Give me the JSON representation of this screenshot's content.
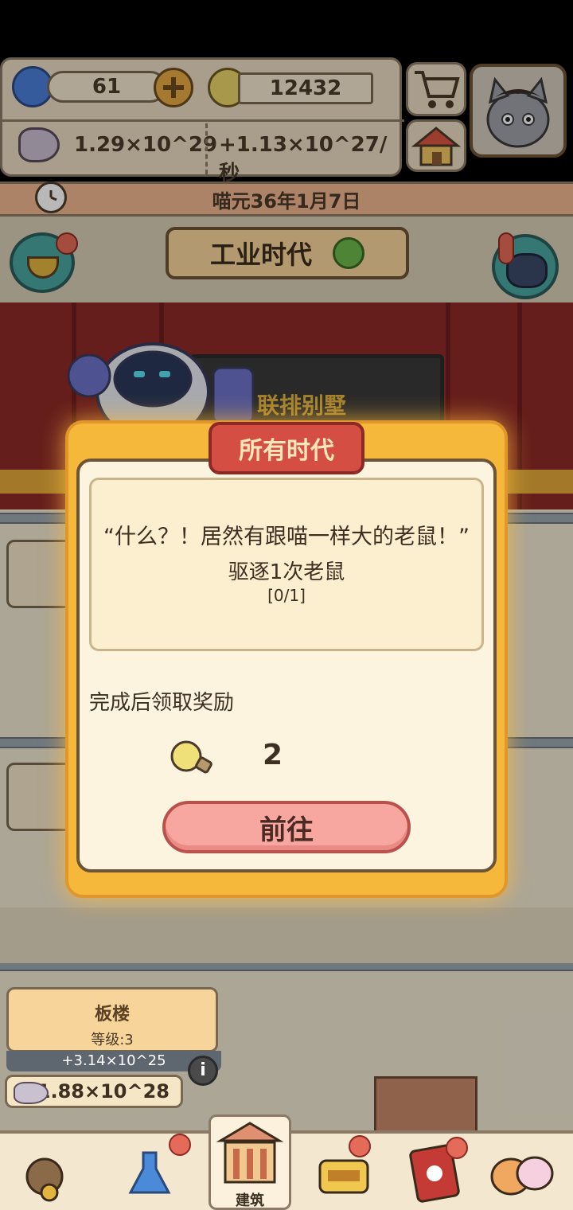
{
  "resources": {
    "gems": "61",
    "bulbs": "12432",
    "fish": "1.29×10^29",
    "fish_rate": "+1.13×10^27/秒"
  },
  "date": "喵元36年1月7日",
  "era": "工业时代",
  "stage_sign": "联排别墅",
  "dialog": {
    "title": "所有时代",
    "quest_quote": "“什么？！居然有跟喵一样大的老鼠！”",
    "quest_task": "驱逐1次老鼠",
    "quest_progress": "[0/1]",
    "reward_label": "完成后领取奖励",
    "reward_count": "2",
    "go_button": "前往"
  },
  "building": {
    "name": "板楼",
    "level": "等级:3",
    "rate": "+3.14×10^25",
    "cost": "1.88×10^28"
  },
  "nav": {
    "active_label": "建筑"
  },
  "icons": {
    "gem": "gem-icon",
    "plus": "plus-icon",
    "bulb": "lightbulb-icon",
    "fish": "fish-icon",
    "cart": "shopping-cart-icon",
    "house": "house-icon",
    "clock": "clock-icon",
    "refresh": "refresh-icon",
    "info": "info-icon"
  },
  "colors": {
    "dialog_border": "#f5b83a",
    "title_banner": "#d54e44",
    "go_button": "#f8a7a0",
    "curtain": "#8e2a28",
    "date_bar": "#f0b690"
  }
}
